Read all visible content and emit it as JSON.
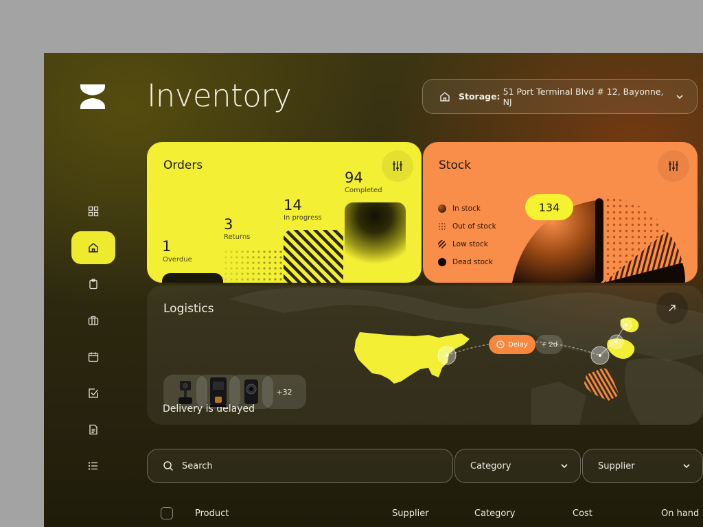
{
  "app": {
    "title": "Inventory",
    "logo": "hourglass-logo"
  },
  "storage": {
    "label": "Storage:",
    "value": "51 Port Terminal Blvd # 12, Bayonne, NJ",
    "icon": "home-icon"
  },
  "sidebar": {
    "items": [
      {
        "name": "grid-icon",
        "active": false
      },
      {
        "name": "home-icon",
        "active": true
      },
      {
        "name": "clipboard-icon",
        "active": false
      },
      {
        "name": "briefcase-icon",
        "active": false
      },
      {
        "name": "calendar-icon",
        "active": false
      },
      {
        "name": "check-square-icon",
        "active": false
      },
      {
        "name": "document-icon",
        "active": false
      },
      {
        "name": "list-icon",
        "active": false
      }
    ]
  },
  "orders": {
    "title": "Orders",
    "stats": [
      {
        "value": "1",
        "label": "Overdue"
      },
      {
        "value": "3",
        "label": "Returns"
      },
      {
        "value": "14",
        "label": "In progress"
      },
      {
        "value": "94",
        "label": "Completed"
      }
    ],
    "colors": {
      "card": "#f3ef34",
      "dark": "#1a1806"
    }
  },
  "stock": {
    "title": "Stock",
    "badge": "134",
    "legend": [
      {
        "label": "In stock"
      },
      {
        "label": "Out of stock"
      },
      {
        "label": "Low stock"
      },
      {
        "label": "Dead stock"
      }
    ],
    "colors": {
      "card": "#f98d4a",
      "accent": "#f5f22f"
    }
  },
  "logistics": {
    "title": "Logistics",
    "delay_message": "Delivery is delayed",
    "delay_pill": "Delay",
    "delay_extra": "+ 2d",
    "more_products": "+32"
  },
  "filters": {
    "search_placeholder": "Search",
    "category_label": "Category",
    "supplier_label": "Supplier"
  },
  "table": {
    "columns": [
      "Product",
      "Supplier",
      "Category",
      "Cost",
      "On hand"
    ]
  }
}
